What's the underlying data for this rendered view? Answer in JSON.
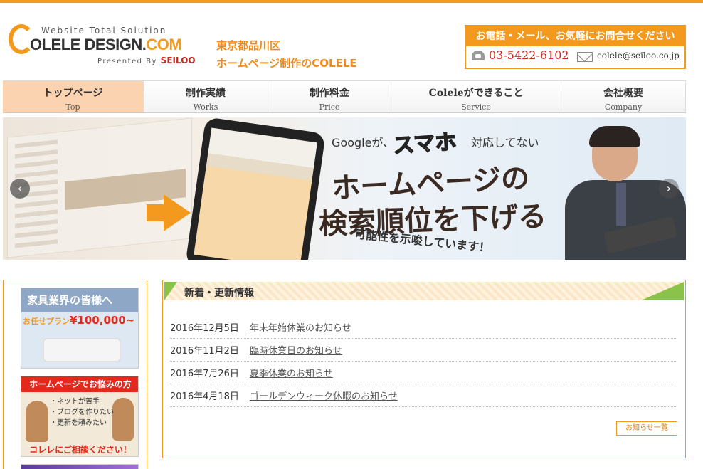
{
  "colors": {
    "accent": "#f39a1e",
    "brand_red": "#d0251b",
    "nav_active": "#fbd3b0",
    "news_green": "#8bc34a"
  },
  "header": {
    "logo": {
      "subtitle": "Website Total Solution",
      "name_main": "OLELE DESIGN.",
      "name_com": "COM",
      "presented_by": "Presented By",
      "presenter": "SEILOO"
    },
    "tagline_line1": "東京都品川区",
    "tagline_line2": "ホームページ制作のCOLELE",
    "contact": {
      "heading": "お電話・メール、お気軽にお問合せください",
      "phone_icon": "phone-icon",
      "phone": "03-5422-6102",
      "mail_icon": "mail-icon",
      "email": "colele@seiloo.co.jp"
    }
  },
  "nav": {
    "items": [
      {
        "jp": "トップページ",
        "en": "Top",
        "active": true
      },
      {
        "jp": "制作実績",
        "en": "Works",
        "active": false
      },
      {
        "jp": "制作料金",
        "en": "Price",
        "active": false
      },
      {
        "jp": "Coleleができること",
        "en": "Service",
        "active": false
      },
      {
        "jp": "会社概要",
        "en": "Company",
        "active": false
      }
    ]
  },
  "banner": {
    "text_google": "Googleが、",
    "text_smaho": "スマホ",
    "text_taiou": "対応してない",
    "text_homepage": "ホームページの",
    "text_ranking": "検索順位を下げる",
    "text_suggest": "可能性を示唆しています！",
    "prev_icon": "‹",
    "next_icon": "›"
  },
  "sidebar": {
    "banner1": {
      "title": "家具業界の皆様へ",
      "plan": "お任せプラン",
      "price": "¥100,000~"
    },
    "banner2": {
      "title": "ホームページでお悩みの方",
      "items": [
        "・ネットが苦手",
        "・ブログを作りたい",
        "・更新を頼みたい"
      ],
      "cta": "コレレにご相談ください！"
    }
  },
  "news": {
    "title": "新着・更新情報",
    "items": [
      {
        "date": "2016年12月5日",
        "title": "年末年始休業のお知らせ"
      },
      {
        "date": "2016年11月2日",
        "title": "臨時休業日のお知らせ"
      },
      {
        "date": "2016年7月26日",
        "title": "夏季休業のお知らせ"
      },
      {
        "date": "2016年4月18日",
        "title": "ゴールデンウィーク休暇のお知らせ"
      }
    ],
    "more": "お知らせ一覧"
  }
}
